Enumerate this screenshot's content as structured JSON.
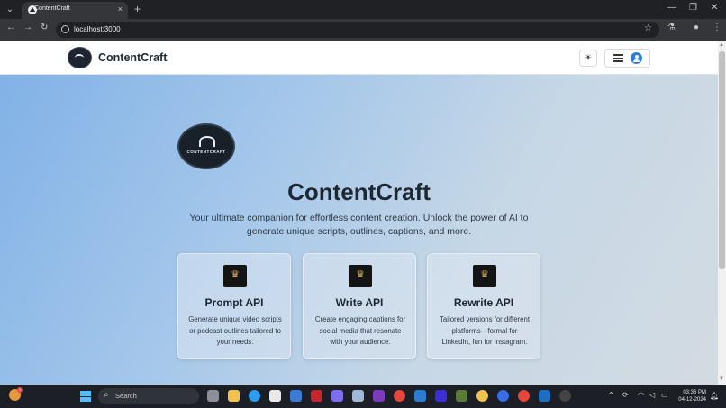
{
  "browser": {
    "tab_title": "ContentCraft",
    "tab_close": "×",
    "new_tab": "+",
    "tab_dropdown": "⌄",
    "window_controls": {
      "minimize": "—",
      "restore": "❐",
      "close": "✕"
    },
    "nav": {
      "back": "←",
      "forward": "→",
      "reload": "↻"
    },
    "url": "localhost:3000",
    "star": "☆",
    "toolbar_icons": {
      "labs": "⚗",
      "profile": "●",
      "menu": "⋮"
    }
  },
  "site": {
    "brand": "ContentCraft",
    "theme_toggle": "☀",
    "hero": {
      "logo_text": "CONTENTCRAFT",
      "title": "ContentCraft",
      "subtitle": "Your ultimate companion for effortless content creation. Unlock the power of AI to generate unique scripts, outlines, captions, and more."
    },
    "cards": [
      {
        "title": "Prompt API",
        "description": "Generate unique video scripts or podcast outlines tailored to your needs."
      },
      {
        "title": "Write API",
        "description": "Create engaging captions for social media that resonate with your audience."
      },
      {
        "title": "Rewrite API",
        "description": "Tailored versions for different platforms—formal for LinkedIn, fun for Instagram."
      }
    ]
  },
  "taskbar": {
    "search_placeholder": "Search",
    "weather_badge": "1",
    "time": "03:36 PM",
    "date": "04-12-2024"
  },
  "colors": {
    "accent": "#2f7bdc",
    "brand_dark": "#182029",
    "gradient_start": "#7fb0e6",
    "gradient_end": "#d3dbe2"
  }
}
